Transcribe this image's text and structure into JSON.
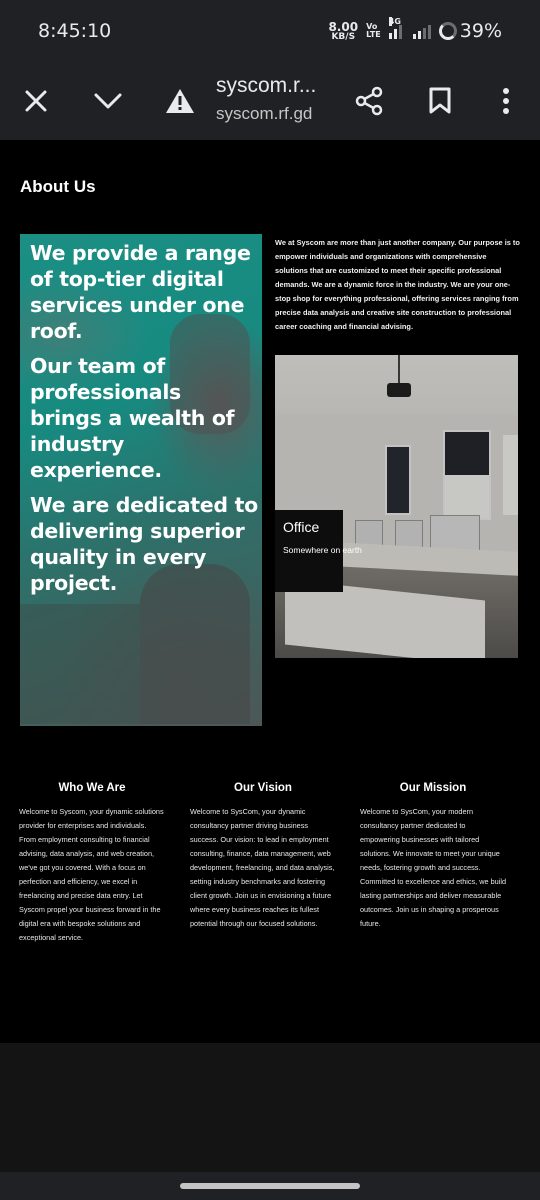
{
  "status_bar": {
    "time": "8:45:10",
    "net_speed_value": "8.00",
    "net_speed_unit": "KB/S",
    "volte_top": "Vo",
    "volte_bottom": "LTE",
    "signal_label": "4G",
    "battery": "39%"
  },
  "browser": {
    "title": "syscom.r...",
    "url": "syscom.rf.gd",
    "icons": [
      "close-icon",
      "chevron-down-icon",
      "warning-icon",
      "share-icon",
      "bookmark-icon",
      "more-vert-icon"
    ]
  },
  "about": {
    "heading": "About Us",
    "hero_lines": [
      "We provide a range of top-tier digital services under one roof.",
      "Our team of professionals brings a wealth of industry experience.",
      "We are dedicated to delivering superior quality in every project."
    ],
    "intro": "We at Syscom are more than just another company. Our purpose is to empower individuals and organizations with comprehensive solutions that are customized to meet their specific professional demands. We are a dynamic force in the industry. We are your one-stop shop for everything professional, offering services ranging from precise data analysis and creative site construction to professional career coaching and financial advising.",
    "office_title": "Office",
    "office_subtitle": "Somewhere on earth"
  },
  "columns": [
    {
      "title": "Who We Are",
      "body": "Welcome to Syscom, your dynamic solutions provider for enterprises and individuals. From employment consulting to financial advising, data analysis, and web creation, we've got you covered. With a focus on perfection and efficiency, we excel in freelancing and precise data entry. Let Syscom propel your business forward in the digital era with bespoke solutions and exceptional service."
    },
    {
      "title": "Our Vision",
      "body": "Welcome to SysCom, your dynamic consultancy partner driving business success. Our vision: to lead in employment consulting, finance, data management, web development, freelancing, and data analysis, setting industry benchmarks and fostering client growth. Join us in envisioning a future where every business reaches its fullest potential through our focused solutions."
    },
    {
      "title": "Our Mission",
      "body": "Welcome to SysCom, your modern consultancy partner dedicated to empowering businesses with tailored solutions. We innovate to meet your unique needs, fostering growth and success. Committed to excellence and ethics, we build lasting partnerships and deliver measurable outcomes. Join us in shaping a prosperous future."
    }
  ]
}
